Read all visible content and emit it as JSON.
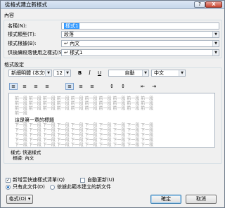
{
  "dialog": {
    "title": "從格式建立新樣式",
    "help_label": "?",
    "close_label": "X"
  },
  "properties": {
    "section_label": "內容",
    "name_label": "名稱(N):",
    "name_value": "樣式1",
    "type_label": "樣式類型(T):",
    "type_value": "段落",
    "based_on_label": "樣式根據(B):",
    "based_on_value": "↵ 內文",
    "following_label": "供後續段落使用之樣式(S):",
    "following_value": "↵ 樣式1"
  },
  "formatting": {
    "section_label": "格式設定",
    "font": "新細明體 (本文中",
    "size": "12",
    "bold": "B",
    "italic": "I",
    "underline": "U",
    "color": "自動",
    "language": "中文",
    "dropdown_glyph": "▼"
  },
  "paragraph_tools": [
    "≡",
    "≡",
    "≡",
    "≡",
    "≡",
    "≡",
    "≡",
    "↕",
    "↕",
    "⇤",
    "⇥"
  ],
  "preview": {
    "prev_lines": [
      "前一段 前一段 前一段 前一段 前一段 前一段 前一段 前一段 前一段 前一段",
      "前一段 前一段 前一段 前一段 前一段 前一段 前一段 前一段 前一段 前一段",
      "前一段 前一段 前一段 前一段 前一段 前一段 前一段 前一段 前一段 前一段",
      "前一段"
    ],
    "heading": "這是第一章的標題",
    "next_lines": [
      "下一段 下一段 下一段 下一段 下一段 下一段 下一段 下一段 下一段 下一段",
      "下一段 下一段 下一段 下一段 下一段 下一段 下一段 下一段 下一段 下一段",
      "下一段 下一段 下一段 下一段 下一段 下一段 下一段 下一段 下一段 下一段",
      "下一段 下一段 下一段 下一段 下一段 下一段 下一段 下一段 下一段 下一段",
      "下一段 下一段 下一段 下一段 下一段 下一段 下一段 下一段 下一段 下一段"
    ]
  },
  "description": {
    "line1": "樣式: 快速樣式",
    "line2": "根據: 內文"
  },
  "options": {
    "quick_style_label": "新增至快速樣式清單(Q)",
    "quick_style_checked": true,
    "auto_update_label": "自動更新(U)",
    "auto_update_checked": false,
    "this_doc_label": "只有此文件(D)",
    "new_docs_label": "依據此範本建立的新文件"
  },
  "buttons": {
    "format_label": "格式(O) ▾",
    "ok_label": "確定",
    "cancel_label": "取消"
  }
}
